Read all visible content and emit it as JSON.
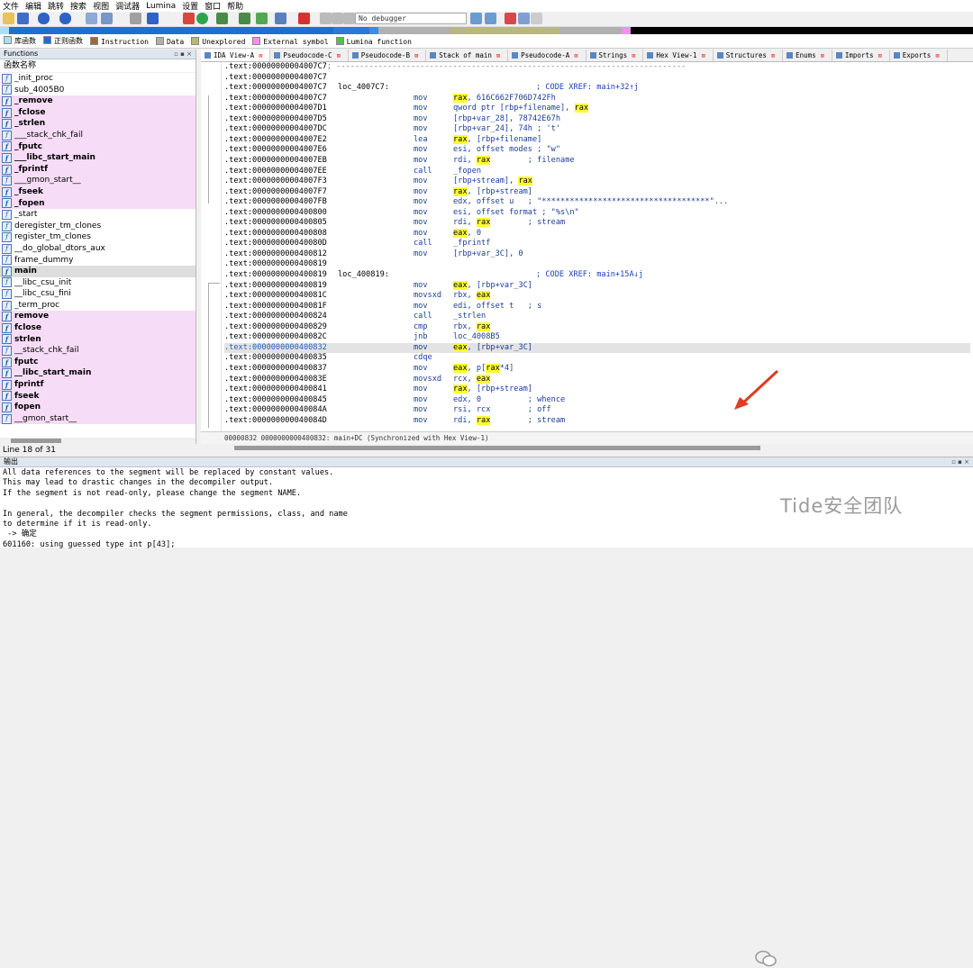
{
  "menu": [
    "文件",
    "编辑",
    "跳转",
    "搜索",
    "视图",
    "调试器",
    "Lumina",
    "设置",
    "窗口",
    "帮助"
  ],
  "toolbar": {
    "debugger": "No debugger"
  },
  "legend": [
    {
      "label": "库函数",
      "color": "#a8e0f0"
    },
    {
      "label": "正则函数",
      "color": "#1f6fd0"
    },
    {
      "label": "Instruction",
      "color": "#9b6a3c"
    },
    {
      "label": "Data",
      "color": "#b0b0b0"
    },
    {
      "label": "Unexplored",
      "color": "#b8b878"
    },
    {
      "label": "External symbol",
      "color": "#f58ef0"
    },
    {
      "label": "Lumina function",
      "color": "#4ec24e"
    }
  ],
  "functions": {
    "title": "Functions",
    "column": "函数名称",
    "status": "Line 18 of 31",
    "items": [
      {
        "name": "_init_proc",
        "style": "white"
      },
      {
        "name": "sub_4005B0",
        "style": "white"
      },
      {
        "name": "_remove",
        "style": "pink-bold"
      },
      {
        "name": "_fclose",
        "style": "pink-bold"
      },
      {
        "name": "_strlen",
        "style": "pink-bold"
      },
      {
        "name": "___stack_chk_fail",
        "style": "pink"
      },
      {
        "name": "_fputc",
        "style": "pink-bold"
      },
      {
        "name": "___libc_start_main",
        "style": "pink-bold"
      },
      {
        "name": "_fprintf",
        "style": "pink-bold"
      },
      {
        "name": "___gmon_start__",
        "style": "pink"
      },
      {
        "name": "_fseek",
        "style": "pink-bold"
      },
      {
        "name": "_fopen",
        "style": "pink-bold"
      },
      {
        "name": "_start",
        "style": "white"
      },
      {
        "name": "deregister_tm_clones",
        "style": "white"
      },
      {
        "name": "register_tm_clones",
        "style": "white"
      },
      {
        "name": "__do_global_dtors_aux",
        "style": "white"
      },
      {
        "name": "frame_dummy",
        "style": "white"
      },
      {
        "name": "main",
        "style": "sel-bold"
      },
      {
        "name": "__libc_csu_init",
        "style": "white"
      },
      {
        "name": "__libc_csu_fini",
        "style": "white"
      },
      {
        "name": "_term_proc",
        "style": "white"
      },
      {
        "name": "remove",
        "style": "pink-bold"
      },
      {
        "name": "fclose",
        "style": "pink-bold"
      },
      {
        "name": "strlen",
        "style": "pink-bold"
      },
      {
        "name": "__stack_chk_fail",
        "style": "pink"
      },
      {
        "name": "fputc",
        "style": "pink-bold"
      },
      {
        "name": "__libc_start_main",
        "style": "pink-bold"
      },
      {
        "name": "fprintf",
        "style": "pink-bold"
      },
      {
        "name": "fseek",
        "style": "pink-bold"
      },
      {
        "name": "fopen",
        "style": "pink-bold"
      },
      {
        "name": "__gmon_start__",
        "style": "pink"
      }
    ]
  },
  "tabs": [
    {
      "label": "IDA View-A",
      "active": true
    },
    {
      "label": "Pseudocode-C"
    },
    {
      "label": "Pseudocode-B"
    },
    {
      "label": "Stack of main"
    },
    {
      "label": "Pseudocode-A"
    },
    {
      "label": "Strings"
    },
    {
      "label": "Hex View-1"
    },
    {
      "label": "Structures"
    },
    {
      "label": "Enums"
    },
    {
      "label": "Imports"
    },
    {
      "label": "Exports"
    }
  ],
  "code_lines": [
    {
      "addr": ".text:00000000004007C7",
      "sep": true,
      "sep_text": "; ---------------------------------------------------------------------------"
    },
    {
      "addr": ".text:00000000004007C7"
    },
    {
      "addr": ".text:00000000004007C7",
      "label": "loc_4007C7:",
      "xref": "; CODE XREF: main+32↑j"
    },
    {
      "addr": ".text:00000000004007C7",
      "mn": "mov",
      "ops": [
        [
          "rax",
          true
        ],
        [
          ", 616C662F706D742Fh",
          false
        ]
      ]
    },
    {
      "addr": ".text:00000000004007D1",
      "mn": "mov",
      "ops": [
        [
          "qword ptr [rbp+filename], ",
          false
        ],
        [
          "rax",
          true
        ]
      ]
    },
    {
      "addr": ".text:00000000004007D5",
      "mn": "mov",
      "ops": [
        [
          "[rbp+var_28], 78742E67h",
          false
        ]
      ]
    },
    {
      "addr": ".text:00000000004007DC",
      "mn": "mov",
      "ops": [
        [
          "[rbp+var_24], 74h ; 't'",
          false
        ]
      ]
    },
    {
      "addr": ".text:00000000004007E2",
      "mn": "lea",
      "ops": [
        [
          "rax",
          true
        ],
        [
          ", [rbp+filename]",
          false
        ]
      ]
    },
    {
      "addr": ".text:00000000004007E6",
      "mn": "mov",
      "ops": [
        [
          "esi, offset modes ; \"w\"",
          false
        ]
      ]
    },
    {
      "addr": ".text:00000000004007EB",
      "mn": "mov",
      "ops": [
        [
          "rdi, ",
          false
        ],
        [
          "rax",
          true
        ],
        [
          "        ; filename",
          false
        ]
      ]
    },
    {
      "addr": ".text:00000000004007EE",
      "mn": "call",
      "ops": [
        [
          "_fopen",
          false
        ]
      ]
    },
    {
      "addr": ".text:00000000004007F3",
      "mn": "mov",
      "ops": [
        [
          "[rbp+stream], ",
          false
        ],
        [
          "rax",
          true
        ]
      ]
    },
    {
      "addr": ".text:00000000004007F7",
      "mn": "mov",
      "ops": [
        [
          "rax",
          true
        ],
        [
          ", [rbp+stream]",
          false
        ]
      ]
    },
    {
      "addr": ".text:00000000004007FB",
      "mn": "mov",
      "ops": [
        [
          "edx, offset u   ; \"************************************\"...",
          false
        ]
      ]
    },
    {
      "addr": ".text:0000000000400800",
      "mn": "mov",
      "ops": [
        [
          "esi, offset format ; \"%s\\n\"",
          false
        ]
      ]
    },
    {
      "addr": ".text:0000000000400805",
      "mn": "mov",
      "ops": [
        [
          "rdi, ",
          false
        ],
        [
          "rax",
          true
        ],
        [
          "        ; stream",
          false
        ]
      ]
    },
    {
      "addr": ".text:0000000000400808",
      "mn": "mov",
      "ops": [
        [
          "eax",
          true
        ],
        [
          ", 0",
          false
        ]
      ]
    },
    {
      "addr": ".text:000000000040080D",
      "mn": "call",
      "ops": [
        [
          "_fprintf",
          false
        ]
      ]
    },
    {
      "addr": ".text:0000000000400812",
      "mn": "mov",
      "ops": [
        [
          "[rbp+var_3C], 0",
          false
        ]
      ]
    },
    {
      "addr": ".text:0000000000400819"
    },
    {
      "addr": ".text:0000000000400819",
      "label": "loc_400819:",
      "xref": "; CODE XREF: main+15A↓j"
    },
    {
      "addr": ".text:0000000000400819",
      "mn": "mov",
      "ops": [
        [
          "eax",
          true
        ],
        [
          ", [rbp+var_3C]",
          false
        ]
      ]
    },
    {
      "addr": ".text:000000000040081C",
      "mn": "movsxd",
      "ops": [
        [
          "rbx, ",
          false
        ],
        [
          "eax",
          true
        ]
      ]
    },
    {
      "addr": ".text:000000000040081F",
      "mn": "mov",
      "ops": [
        [
          "edi, offset t   ; s",
          false
        ]
      ]
    },
    {
      "addr": ".text:0000000000400824",
      "mn": "call",
      "ops": [
        [
          "_strlen",
          false
        ]
      ]
    },
    {
      "addr": ".text:0000000000400829",
      "mn": "cmp",
      "ops": [
        [
          "rbx, ",
          false
        ],
        [
          "rax",
          true
        ]
      ]
    },
    {
      "addr": ".text:000000000040082C",
      "mn": "jnb",
      "ops": [
        [
          "loc_4008B5",
          false
        ]
      ]
    },
    {
      "addr": ".text:0000000000400832",
      "mn": "mov",
      "ops": [
        [
          "eax",
          true
        ],
        [
          ", [rbp+var_3C]",
          false
        ]
      ],
      "highlight": true
    },
    {
      "addr": ".text:0000000000400835",
      "mn": "cdqe",
      "ops": []
    },
    {
      "addr": ".text:0000000000400837",
      "mn": "mov",
      "ops": [
        [
          "eax",
          true
        ],
        [
          ", p[",
          false
        ],
        [
          "rax",
          true
        ],
        [
          "*4]",
          false
        ]
      ]
    },
    {
      "addr": ".text:000000000040083E",
      "mn": "movsxd",
      "ops": [
        [
          "rcx, ",
          false
        ],
        [
          "eax",
          true
        ]
      ]
    },
    {
      "addr": ".text:0000000000400841",
      "mn": "mov",
      "ops": [
        [
          "rax",
          true
        ],
        [
          ", [rbp+stream]",
          false
        ]
      ]
    },
    {
      "addr": ".text:0000000000400845",
      "mn": "mov",
      "ops": [
        [
          "edx, 0          ; whence",
          false
        ]
      ]
    },
    {
      "addr": ".text:000000000040084A",
      "mn": "mov",
      "ops": [
        [
          "rsi, rcx        ; off",
          false
        ]
      ]
    },
    {
      "addr": ".text:000000000040084D",
      "mn": "mov",
      "ops": [
        [
          "rdi, ",
          false
        ],
        [
          "rax",
          true
        ],
        [
          "        ; stream",
          false
        ]
      ]
    }
  ],
  "code_status": "00000832 0000000000400832: main+DC (Synchronized with Hex View-1)",
  "output": {
    "title": "输出",
    "lines": [
      "All data references to the segment will be replaced by constant values.",
      "This may lead to drastic changes in the decompiler output.",
      "If the segment is not read-only, please change the segment NAME.",
      "",
      "In general, the decompiler checks the segment permissions, class, and name",
      "to determine if it is read-only.",
      " -> 确定",
      "601160: using guessed type int p[43];"
    ]
  },
  "watermark": "Tide安全团队"
}
